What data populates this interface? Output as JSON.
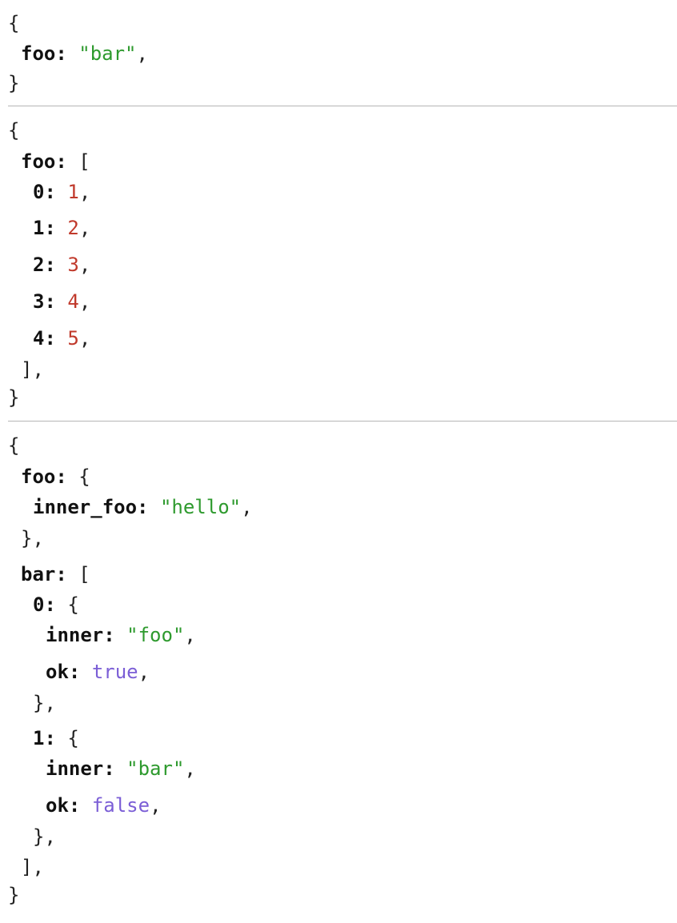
{
  "colors": {
    "string": "#2e9a2e",
    "number": "#c0392b",
    "boolean": "#7b5ed6",
    "divider": "#b5b5b5"
  },
  "punct": {
    "open_brace": "{",
    "close_brace": "}",
    "open_bracket": "[",
    "close_bracket_comma": "],",
    "close_brace_comma": "},",
    "comma": ","
  },
  "block1": {
    "foo_key": "foo:",
    "foo_value": "\"bar\""
  },
  "block2": {
    "foo_key": "foo:",
    "items": [
      {
        "index": "0:",
        "value": "1"
      },
      {
        "index": "1:",
        "value": "2"
      },
      {
        "index": "2:",
        "value": "3"
      },
      {
        "index": "3:",
        "value": "4"
      },
      {
        "index": "4:",
        "value": "5"
      }
    ]
  },
  "block3": {
    "foo_key": "foo:",
    "inner_foo_key": "inner_foo:",
    "inner_foo_value": "\"hello\"",
    "bar_key": "bar:",
    "items": [
      {
        "index": "0:",
        "inner_key": "inner:",
        "inner_value": "\"foo\"",
        "ok_key": "ok:",
        "ok_value": "true"
      },
      {
        "index": "1:",
        "inner_key": "inner:",
        "inner_value": "\"bar\"",
        "ok_key": "ok:",
        "ok_value": "false"
      }
    ]
  }
}
